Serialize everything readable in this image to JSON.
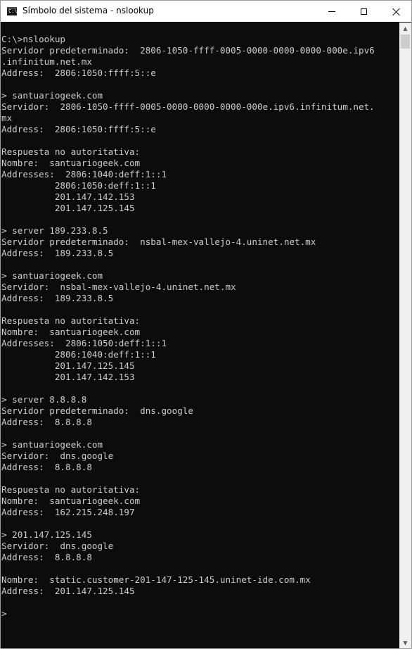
{
  "window": {
    "title": "Símbolo del sistema - nslookup",
    "app_icon_glyph": "C:\\",
    "buttons": {
      "minimize": "minimize-icon",
      "maximize": "maximize-icon",
      "close": "close-icon"
    }
  },
  "console": {
    "text": "C:\\>nslookup\nServidor predeterminado:  2806-1050-ffff-0005-0000-0000-0000-000e.ipv6\n.infinitum.net.mx\nAddress:  2806:1050:ffff:5::e\n\n> santuariogeek.com\nServidor:  2806-1050-ffff-0005-0000-0000-0000-000e.ipv6.infinitum.net.\nmx\nAddress:  2806:1050:ffff:5::e\n\nRespuesta no autoritativa:\nNombre:  santuariogeek.com\nAddresses:  2806:1040:deff:1::1\n          2806:1050:deff:1::1\n          201.147.142.153\n          201.147.125.145\n\n> server 189.233.8.5\nServidor predeterminado:  nsbal-mex-vallejo-4.uninet.net.mx\nAddress:  189.233.8.5\n\n> santuariogeek.com\nServidor:  nsbal-mex-vallejo-4.uninet.net.mx\nAddress:  189.233.8.5\n\nRespuesta no autoritativa:\nNombre:  santuariogeek.com\nAddresses:  2806:1050:deff:1::1\n          2806:1040:deff:1::1\n          201.147.125.145\n          201.147.142.153\n\n> server 8.8.8.8\nServidor predeterminado:  dns.google\nAddress:  8.8.8.8\n\n> santuariogeek.com\nServidor:  dns.google\nAddress:  8.8.8.8\n\nRespuesta no autoritativa:\nNombre:  santuariogeek.com\nAddress:  162.215.248.197\n\n> 201.147.125.145\nServidor:  dns.google\nAddress:  8.8.8.8\n\nNombre:  static.customer-201-147-125-145.uninet-ide.com.mx\nAddress:  201.147.125.145\n\n>"
  },
  "scrollbar": {
    "up_arrow": "▲",
    "down_arrow": "▼"
  },
  "colors": {
    "console_bg": "#0c0c0c",
    "console_fg": "#cccccc",
    "titlebar_bg": "#ffffff"
  }
}
